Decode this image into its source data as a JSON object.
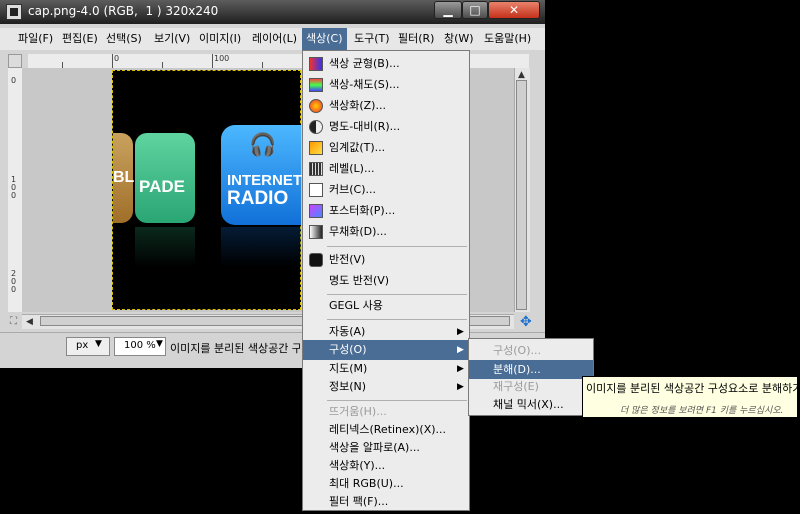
{
  "window": {
    "title": "cap.png-4.0 (RGB,  1 ) 320x240",
    "min_label": "▁",
    "max_label": "□",
    "close_label": "✕"
  },
  "menubar": [
    "파일(F)",
    "편집(E)",
    "선택(S)",
    "보기(V)",
    "이미지(I)",
    "레이어(L)",
    "색상(C)",
    "도구(T)",
    "필터(R)",
    "창(W)",
    "도움말(H)"
  ],
  "ruler": {
    "top_labels": [
      "0",
      "100"
    ],
    "left_labels": [
      "0",
      "1\n0\n0",
      "2\n0\n0"
    ]
  },
  "image": {
    "app1_label": "BL",
    "app2_label": "PADE",
    "app3_label_1": "INTERNET",
    "app3_label_2": "RADIO"
  },
  "statusbar": {
    "unit": "px",
    "zoom": "100 %",
    "status_text": "이미지를 분리된 색상공간 구성요소로 분해하기"
  },
  "color_menu": {
    "items": [
      {
        "label": "색상 균형(B)...",
        "icon": "color-balance-icon",
        "disabled": false
      },
      {
        "label": "색상-채도(S)...",
        "icon": "hue-saturation-icon",
        "disabled": false
      },
      {
        "label": "색상화(Z)...",
        "icon": "colorize-icon",
        "disabled": false
      },
      {
        "label": "명도-대비(R)...",
        "icon": "brightness-contrast-icon",
        "disabled": false
      },
      {
        "label": "임계값(T)...",
        "icon": "threshold-icon",
        "disabled": false
      },
      {
        "label": "레벨(L)...",
        "icon": "levels-icon",
        "disabled": false
      },
      {
        "label": "커브(C)...",
        "icon": "curves-icon",
        "disabled": false
      },
      {
        "label": "포스터화(P)...",
        "icon": "posterize-icon",
        "disabled": false
      },
      {
        "label": "무채화(D)...",
        "icon": "desaturate-icon",
        "disabled": false
      },
      {
        "label": "반전(V)",
        "icon": "invert-icon",
        "disabled": false
      },
      {
        "label": "명도 반전(V)",
        "icon": "",
        "disabled": false
      },
      {
        "label": "GEGL 사용",
        "icon": "",
        "disabled": false
      },
      {
        "label": "자동(A)",
        "icon": "",
        "disabled": false,
        "submenu": true
      },
      {
        "label": "구성(O)",
        "icon": "",
        "disabled": false,
        "submenu": true,
        "highlighted": true
      },
      {
        "label": "지도(M)",
        "icon": "",
        "disabled": false,
        "submenu": true
      },
      {
        "label": "정보(N)",
        "icon": "",
        "disabled": false,
        "submenu": true
      },
      {
        "label": "뜨거움(H)...",
        "icon": "",
        "disabled": true
      },
      {
        "label": "레티넥스(Retinex)(X)...",
        "icon": "",
        "disabled": false
      },
      {
        "label": "색상을 알파로(A)...",
        "icon": "",
        "disabled": false
      },
      {
        "label": "색상화(Y)...",
        "icon": "",
        "disabled": false
      },
      {
        "label": "최대 RGB(U)...",
        "icon": "",
        "disabled": false
      },
      {
        "label": "필터 팩(F)...",
        "icon": "",
        "disabled": false
      }
    ],
    "submenu_arrow": "▶"
  },
  "sub_menu": {
    "items": [
      {
        "label": "구성(O)...",
        "disabled": true
      },
      {
        "label": "분해(D)...",
        "disabled": false,
        "highlighted": true
      },
      {
        "label": "재구성(E)",
        "disabled": true
      },
      {
        "label": "채널 믹서(X)...",
        "disabled": false
      }
    ]
  },
  "tooltip": {
    "main": "이미지를 분리된 색상공간 구성요소로 분해하기",
    "help": "더 많은 정보를 보려면 F1 키를 누르십시오."
  },
  "colors": {
    "highlight": "#4a6d96",
    "tooltip_bg": "#ffffe1",
    "close_btn": "#c4311a"
  }
}
